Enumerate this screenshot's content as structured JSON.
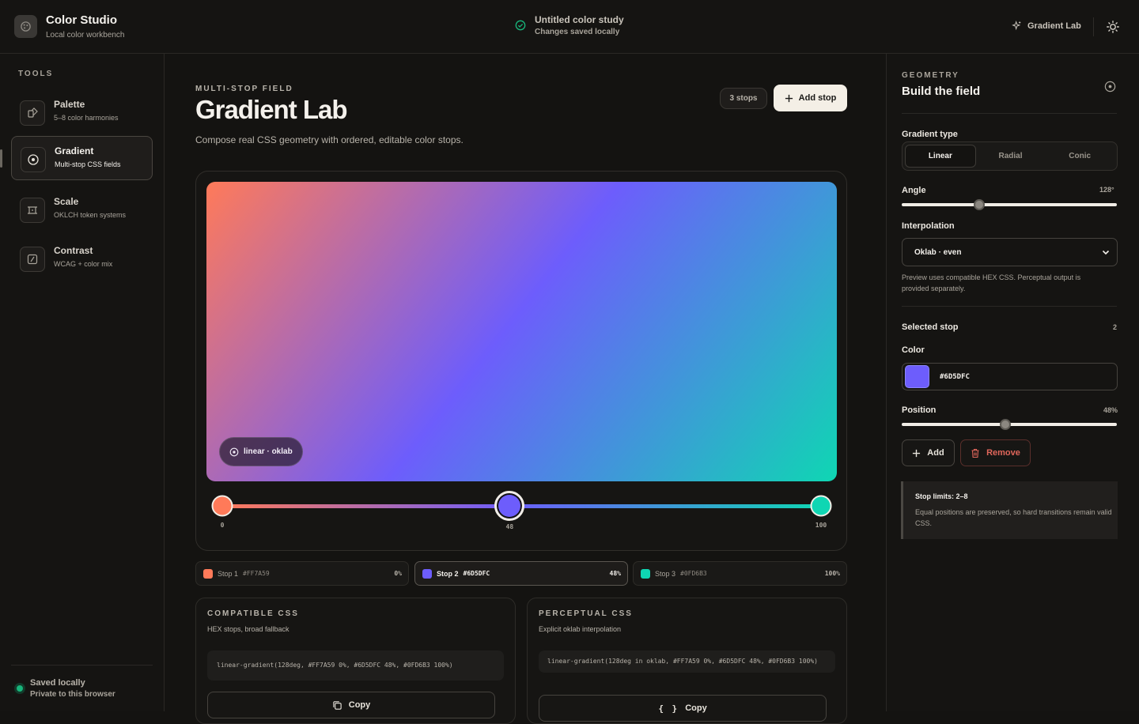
{
  "app": {
    "title": "Color Studio",
    "subtitle": "Local color workbench"
  },
  "document": {
    "title": "Untitled color study",
    "status": "Changes saved locally"
  },
  "topbar": {
    "gradient_link": "Gradient Lab"
  },
  "sidebar": {
    "section_label": "TOOLS",
    "items": [
      {
        "label": "Palette",
        "sub": "5–8 color harmonies",
        "icon": "palette-icon"
      },
      {
        "label": "Gradient",
        "sub": "Multi-stop CSS fields",
        "icon": "gradient-icon"
      },
      {
        "label": "Scale",
        "sub": "OKLCH token systems",
        "icon": "scale-icon"
      },
      {
        "label": "Contrast",
        "sub": "WCAG + color mix",
        "icon": "contrast-icon"
      }
    ],
    "active_index": 1,
    "footer": {
      "title": "Saved locally",
      "sub": "Private to this browser"
    }
  },
  "main": {
    "eyebrow": "MULTI-STOP FIELD",
    "title": "Gradient Lab",
    "description": "Compose real CSS geometry with ordered, editable color stops.",
    "stops_badge": "3 stops",
    "add_stop_label": "Add stop",
    "mode_pill": "linear · oklab"
  },
  "gradient": {
    "type": "linear",
    "angle_deg": 128,
    "stops": [
      {
        "name": "Stop 1",
        "hex": "#FF7A59",
        "position": 0,
        "pct": "0%",
        "label": "0"
      },
      {
        "name": "Stop 2",
        "hex": "#6D5DFC",
        "position": 48,
        "pct": "48%",
        "label": "48"
      },
      {
        "name": "Stop 3",
        "hex": "#0FD6B3",
        "position": 100,
        "pct": "100%",
        "label": "100"
      }
    ],
    "selected_index": 1
  },
  "css": {
    "compatible": {
      "title": "COMPATIBLE CSS",
      "sub": "HEX stops, broad fallback",
      "code": "linear-gradient(128deg, #FF7A59 0%, #6D5DFC 48%, #0FD6B3 100%)",
      "copy_label": "Copy"
    },
    "perceptual": {
      "title": "PERCEPTUAL CSS",
      "sub": "Explicit oklab interpolation",
      "code": "linear-gradient(128deg in oklab, #FF7A59 0%, #6D5DFC 48%, #0FD6B3 100%)",
      "copy_label": "Copy"
    }
  },
  "panel": {
    "eyebrow": "GEOMETRY",
    "title": "Build the field",
    "gradient_type_label": "Gradient type",
    "types": [
      "Linear",
      "Radial",
      "Conic"
    ],
    "active_type_index": 0,
    "angle_label": "Angle",
    "angle_value": "128°",
    "angle_fraction": 0.36,
    "interpolation_label": "Interpolation",
    "interpolation_value": "Oklab · even",
    "note": "Preview uses compatible HEX CSS. Perceptual output is provided separately.",
    "selected_stop_label": "Selected stop",
    "selected_stop_value": "2",
    "color_label": "Color",
    "color_hex": "#6D5DFC",
    "position_label": "Position",
    "position_value": "48%",
    "position_fraction": 0.48,
    "add_label": "Add",
    "remove_label": "Remove",
    "limits_title": "Stop limits: 2–8",
    "limits_text": "Equal positions are preserved, so hard transitions remain valid CSS."
  },
  "colors": {
    "accent_green": "#18B57B",
    "remove_red": "#E0665B",
    "button_light": "#F4EFE6"
  }
}
